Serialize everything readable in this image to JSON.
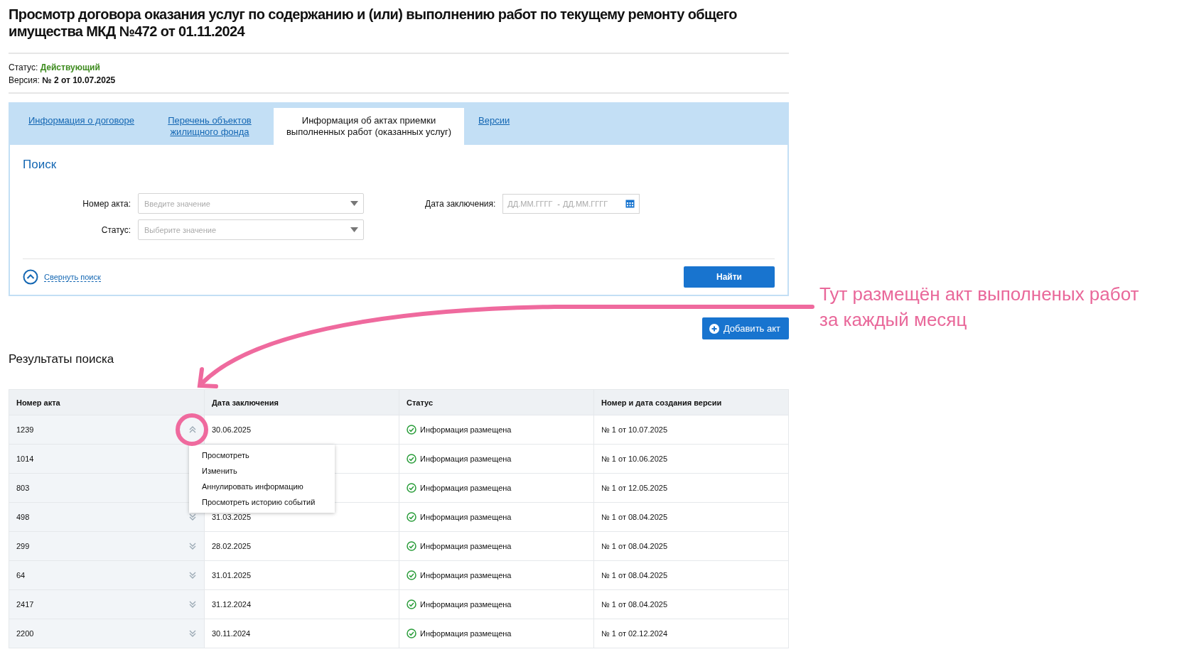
{
  "title": "Просмотр договора оказания услуг по содержанию и (или) выполнению работ по текущему ремонту общего имущества МКД №472 от 01.11.2024",
  "meta": [
    {
      "label": "Статус:",
      "value": "Действующий",
      "kind": "status"
    },
    {
      "label": "Версия:",
      "value": "№ 2 от 10.07.2025",
      "kind": "version"
    }
  ],
  "tabs": [
    {
      "label": "Информация о договоре",
      "selected": false
    },
    {
      "label": "Перечень объектов жилищного фонда",
      "selected": false
    },
    {
      "label": "Информация об актах приемки выполненных работ (оказанных услуг)",
      "selected": true
    },
    {
      "label": "Версии",
      "selected": false
    }
  ],
  "search": {
    "title": "Поиск",
    "fields": [
      {
        "label": "Номер акта:",
        "placeholder": "Введите значение"
      },
      {
        "label": "Статус:",
        "placeholder": "Выберите значение"
      }
    ],
    "date": {
      "label": "Дата заключения:",
      "from_placeholder": "ДД.ММ.ГГГГ",
      "separator": "-",
      "to_placeholder": "ДД.ММ.ГГГГ"
    },
    "collapse_link": "Свернуть поиск",
    "find_button": "Найти"
  },
  "add_button": "Добавить акт",
  "results_title": "Результаты поиска",
  "table": {
    "columns": [
      "Номер акта",
      "Дата заключения",
      "Статус",
      "Номер и дата создания версии"
    ],
    "rows": [
      {
        "number": "1239",
        "expanded": true,
        "date": "30.06.2025",
        "status": "Информация размещена",
        "version": "№ 1 от 10.07.2025"
      },
      {
        "number": "1014",
        "status": "Информация размещена",
        "version": "№ 1 от 10.06.2025"
      },
      {
        "number": "803",
        "status": "Информация размещена",
        "version": "№ 1 от 12.05.2025"
      },
      {
        "number": "498",
        "expanded": false,
        "date": "31.03.2025",
        "status": "Информация размещена",
        "version": "№ 1 от 08.04.2025"
      },
      {
        "number": "299",
        "expanded": false,
        "date": "28.02.2025",
        "status": "Информация размещена",
        "version": "№ 1 от 08.04.2025"
      },
      {
        "number": "64",
        "expanded": false,
        "date": "31.01.2025",
        "status": "Информация размещена",
        "version": "№ 1 от 08.04.2025"
      },
      {
        "number": "2417",
        "expanded": false,
        "date": "31.12.2024",
        "status": "Информация размещена",
        "version": "№ 1 от 08.04.2025"
      },
      {
        "number": "2200",
        "expanded": false,
        "date": "30.11.2024",
        "status": "Информация размещена",
        "version": "№ 1 от 02.12.2024"
      }
    ]
  },
  "row_menu": [
    "Просмотреть",
    "Изменить",
    "Аннулировать информацию",
    "Просмотреть историю событий"
  ],
  "annotation": "Тут размещён акт выполненых работ за каждый месяц"
}
